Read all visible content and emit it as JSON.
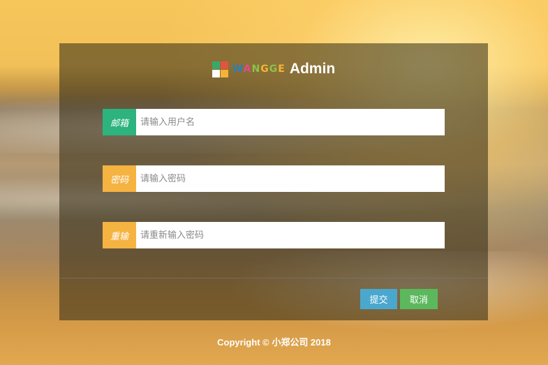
{
  "brand": {
    "letters": [
      "W",
      "A",
      "N",
      "G",
      "G",
      "E"
    ],
    "admin": "Admin",
    "logo_colors": [
      "#3aa86b",
      "#e2543f",
      "#ffffff",
      "#f5b335"
    ]
  },
  "form": {
    "fields": [
      {
        "tag": "邮箱",
        "placeholder": "请输入用户名",
        "value": "",
        "tag_color": "#2db37e"
      },
      {
        "tag": "密码",
        "placeholder": "请输入密码",
        "value": "",
        "tag_color": "#f5b342"
      },
      {
        "tag": "重输",
        "placeholder": "请重新输入密码",
        "value": "",
        "tag_color": "#f5b342"
      }
    ],
    "submit_label": "提交",
    "cancel_label": "取消",
    "submit_color": "#4aa8cf",
    "cancel_color": "#5cb85c"
  },
  "footer": {
    "copyright": "Copyright © 小郑公司 2018"
  }
}
